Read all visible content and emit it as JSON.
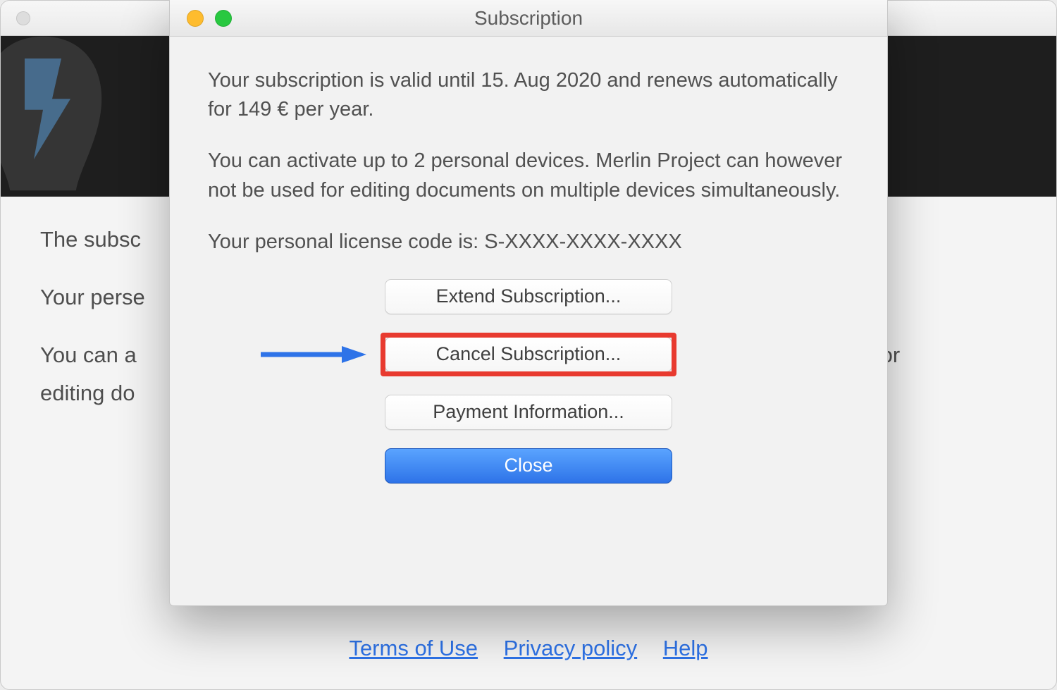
{
  "mainWindow": {
    "p1": "The subsc",
    "p2": "Your perse",
    "p3_left": "You can a",
    "p3_right": "for",
    "p4": "editing do"
  },
  "footer": {
    "terms": "Terms of Use",
    "privacy": "Privacy policy",
    "help": "Help"
  },
  "sheet": {
    "title": "Subscription",
    "paragraph1": "Your subscription is valid until 15. Aug 2020 and renews automatically for 149 € per year.",
    "paragraph2": "You can activate up to 2 personal devices. Merlin Project can however not be used for editing documents on multiple devices simultaneously.",
    "licenseLine": "Your personal license code is: S-XXXX-XXXX-XXXX"
  },
  "buttons": {
    "extend": "Extend Subscription...",
    "cancel": "Cancel Subscription...",
    "payment": "Payment Information...",
    "close": "Close"
  }
}
